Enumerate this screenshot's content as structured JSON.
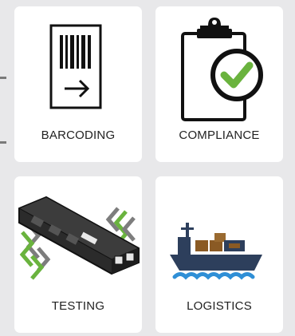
{
  "tiles": [
    {
      "id": "barcoding",
      "label": "BARCODING",
      "icon": "barcode-document-icon"
    },
    {
      "id": "compliance",
      "label": "COMPLIANCE",
      "icon": "clipboard-checkmark-icon"
    },
    {
      "id": "testing",
      "label": "TESTING",
      "icon": "test-device-icon"
    },
    {
      "id": "logistics",
      "label": "LOGISTICS",
      "icon": "cargo-ship-icon"
    }
  ],
  "colors": {
    "background": "#e8e8ea",
    "tile": "#ffffff",
    "check_green": "#6ab33e",
    "ship_navy": "#2d3f5c",
    "water_blue": "#2f8fd6",
    "cargo_brown": "#8a5a24"
  }
}
